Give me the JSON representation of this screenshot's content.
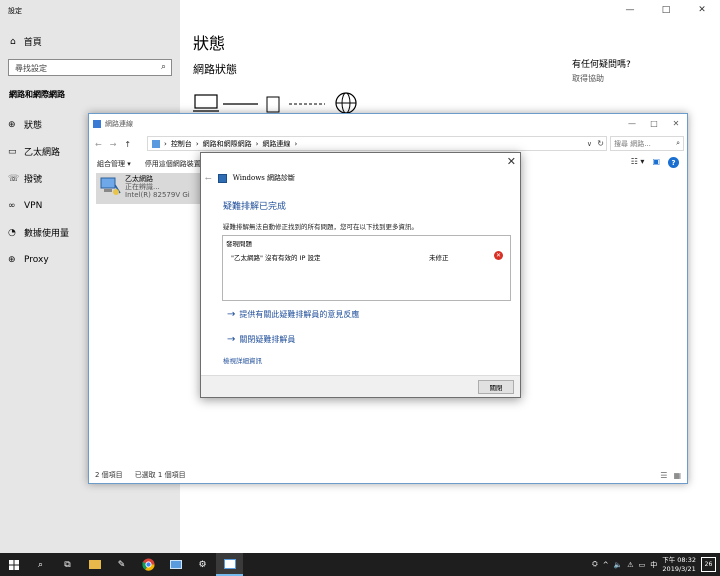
{
  "settings": {
    "title": "設定",
    "controls": {
      "minimize": "—",
      "maximize": "□",
      "close": "✕"
    },
    "home": "首頁",
    "search_placeholder": "尋找設定",
    "section": "網路和網際網路",
    "nav": [
      "狀態",
      "乙太網路",
      "撥號",
      "VPN",
      "數據使用量",
      "Proxy"
    ],
    "status_title": "狀態",
    "network_status": "網路狀態",
    "help_title": "有任何疑問嗎?",
    "help_link": "取得協助"
  },
  "explorer": {
    "title": "網路連線",
    "path": [
      "控制台",
      "網路和網際網路",
      "網路連線"
    ],
    "search_placeholder": "搜尋 網路...",
    "commands": [
      "組合管理 ▾",
      "停用這個網路裝置"
    ],
    "item": {
      "name": "乙太網路",
      "status": "正在辨識...",
      "device": "Intel(R) 82579V Gi"
    },
    "status_count": "2 個項目",
    "status_selected": "已選取 1 個項目"
  },
  "dialog": {
    "header": "Windows 網路診斷",
    "heading": "疑難排解已完成",
    "description": "疑難排解無法自動修正找到的所有問題，您可在以下找到更多資訊。",
    "issues_header": "發現問題",
    "issue_text": "\"乙太網路\" 沒有有效的 IP 設定",
    "issue_status": "未修正",
    "action_feedback": "提供有關此疑難排解員的意見反應",
    "action_close": "關閉疑難排解員",
    "details_link": "檢視詳細資訊",
    "close_button": "關閉"
  },
  "taskbar": {
    "time": "下午 08:32",
    "date": "2019/3/21",
    "ime": "中",
    "notifications": "26"
  }
}
